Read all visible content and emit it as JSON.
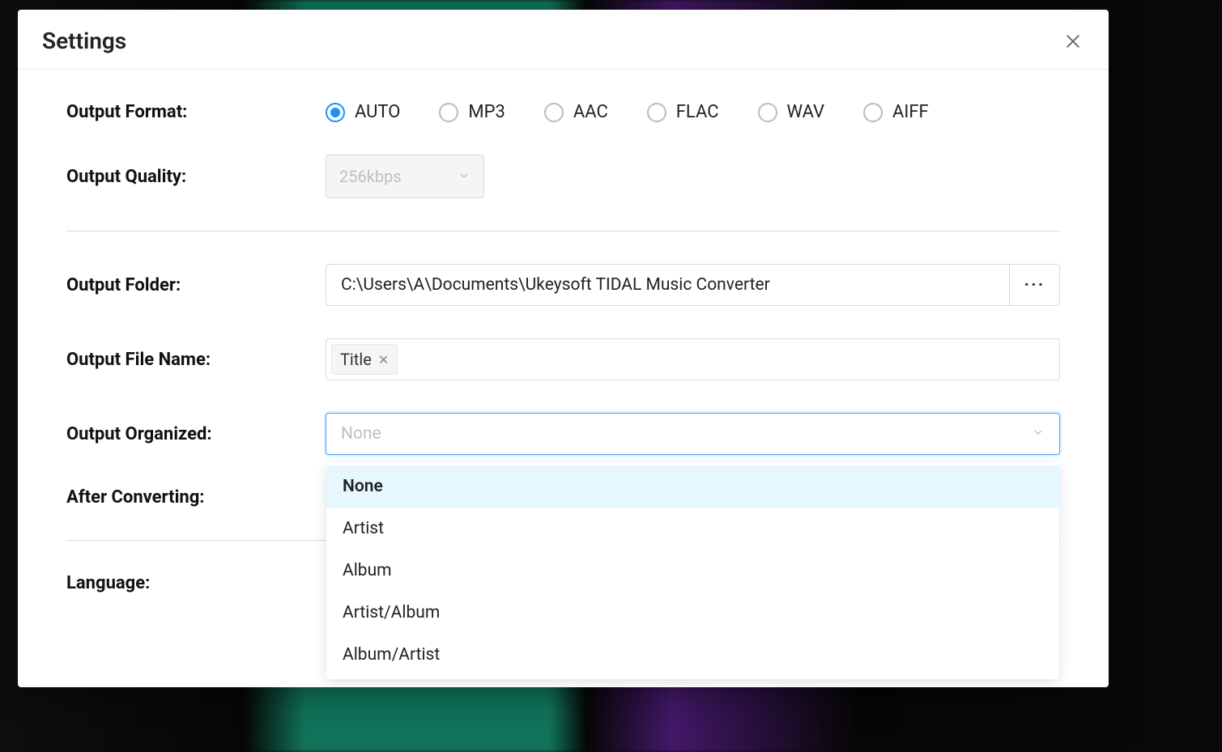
{
  "modal": {
    "title": "Settings"
  },
  "labels": {
    "output_format": "Output Format:",
    "output_quality": "Output Quality:",
    "output_folder": "Output Folder:",
    "output_file_name": "Output File Name:",
    "output_organized": "Output Organized:",
    "after_converting": "After Converting:",
    "language": "Language:"
  },
  "output_format": {
    "selected": "AUTO",
    "options": [
      "AUTO",
      "MP3",
      "AAC",
      "FLAC",
      "WAV",
      "AIFF"
    ]
  },
  "output_quality": {
    "value": "256kbps",
    "disabled": true
  },
  "output_folder": {
    "path": "C:\\Users\\A\\Documents\\Ukeysoft TIDAL Music Converter",
    "browse_icon": "···"
  },
  "output_file_name": {
    "tags": [
      "Title"
    ]
  },
  "output_organized": {
    "placeholder": "None",
    "options": [
      "None",
      "Artist",
      "Album",
      "Artist/Album",
      "Album/Artist"
    ],
    "highlighted": "None"
  }
}
